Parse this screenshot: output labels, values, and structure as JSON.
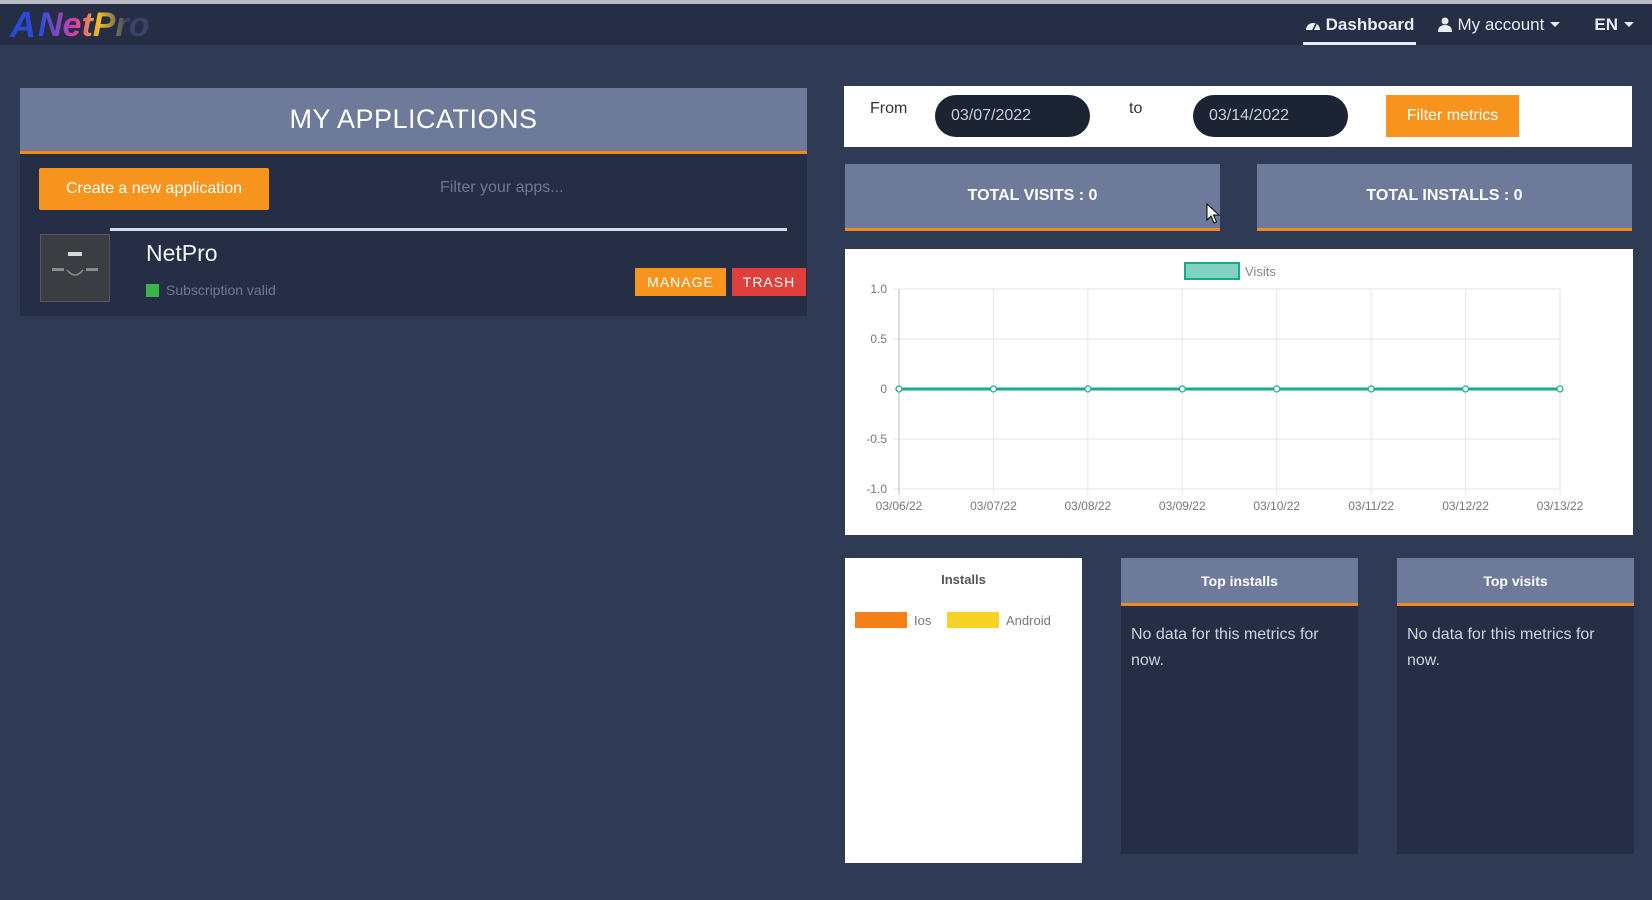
{
  "topbar": {
    "logo_mark": "A",
    "logo_text": "NetPro",
    "nav": {
      "dashboard": "Dashboard",
      "account": "My account",
      "language": "EN"
    }
  },
  "apps": {
    "title": "MY APPLICATIONS",
    "create_button": "Create a new application",
    "filter_placeholder": "Filter your apps...",
    "items": [
      {
        "name": "NetPro",
        "status": "Subscription valid",
        "manage_label": "MANAGE",
        "trash_label": "TRASH"
      }
    ]
  },
  "filters": {
    "from_label": "From",
    "from_value": "03/07/2022",
    "to_label": "to",
    "to_value": "03/14/2022",
    "filter_button": "Filter metrics"
  },
  "stats": {
    "total_visits": "TOTAL VISITS : 0",
    "total_installs": "TOTAL INSTALLS : 0"
  },
  "chart_data": {
    "type": "line",
    "categories": [
      "03/06/22",
      "03/07/22",
      "03/08/22",
      "03/09/22",
      "03/10/22",
      "03/11/22",
      "03/12/22",
      "03/13/22"
    ],
    "series": [
      {
        "name": "Visits",
        "values": [
          0,
          0,
          0,
          0,
          0,
          0,
          0,
          0
        ],
        "color": "#1aaa8a"
      }
    ],
    "y_ticks": [
      "1.0",
      "0.5",
      "0",
      "-0.5",
      "-1.0"
    ],
    "ylim": [
      -1.0,
      1.0
    ],
    "grid": true,
    "legend": "top"
  },
  "installs": {
    "title": "Installs",
    "legend": [
      {
        "label": "Ios",
        "color": "#f57f17"
      },
      {
        "label": "Android",
        "color": "#f5d327"
      }
    ]
  },
  "top_installs": {
    "title": "Top installs",
    "message": "No data for this metrics for now."
  },
  "top_visits": {
    "title": "Top visits",
    "message": "No data for this metrics for now."
  },
  "colors": {
    "accent": "#f7941d",
    "danger": "#e0403c",
    "panel": "#6e7a9a",
    "background": "#2f3a54"
  }
}
